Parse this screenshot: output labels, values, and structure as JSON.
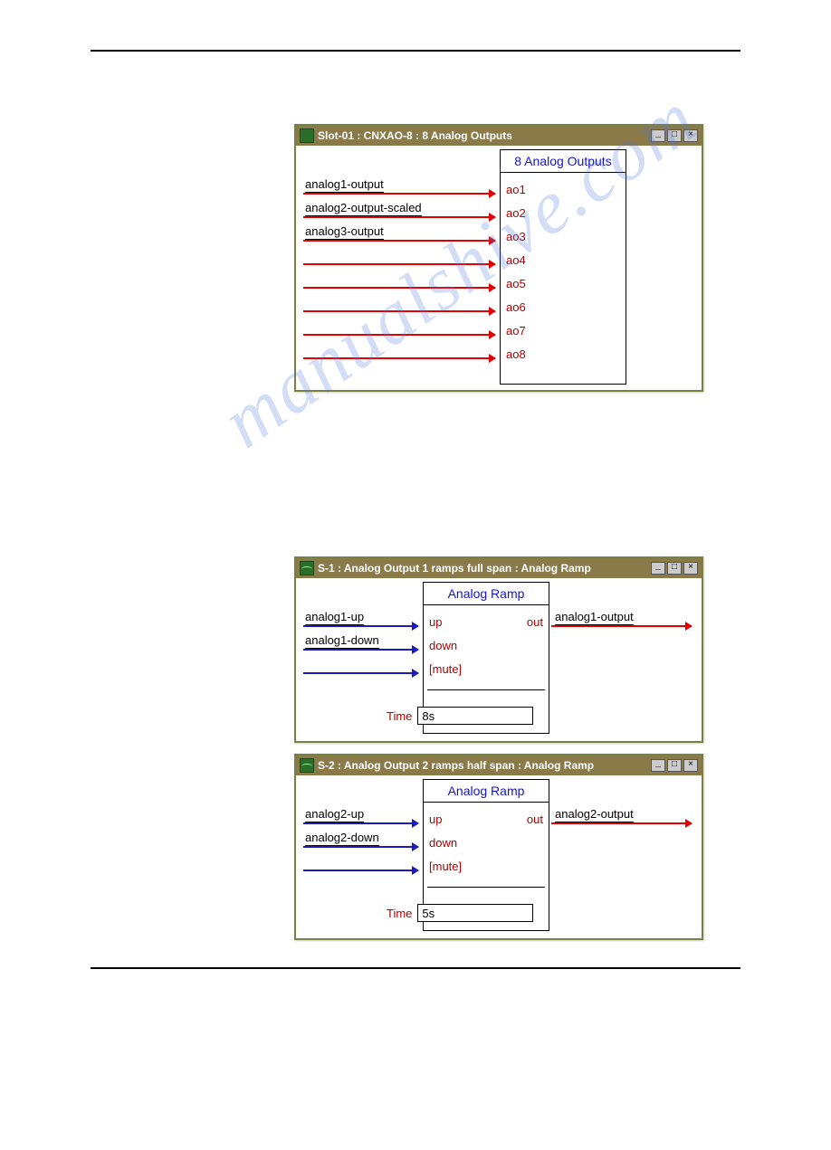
{
  "watermark": "manualshive.com",
  "win1": {
    "title": "Slot-01 : CNXAO-8 : 8 Analog Outputs",
    "header": "8 Analog Outputs",
    "ports": [
      "ao1",
      "ao2",
      "ao3",
      "ao4",
      "ao5",
      "ao6",
      "ao7",
      "ao8"
    ],
    "signals": [
      "analog1-output",
      "analog2-output-scaled",
      "analog3-output"
    ]
  },
  "win2": {
    "title": "S-1 : Analog Output 1 ramps full span : Analog Ramp",
    "header": "Analog Ramp",
    "in_ports": [
      "up",
      "down",
      "[mute]"
    ],
    "out_port": "out",
    "in_signals": [
      "analog1-up",
      "analog1-down"
    ],
    "out_signal": "analog1-output",
    "time_label": "Time",
    "time_value": "8s"
  },
  "win3": {
    "title": "S-2 : Analog Output 2 ramps half span : Analog Ramp",
    "header": "Analog Ramp",
    "in_ports": [
      "up",
      "down",
      "[mute]"
    ],
    "out_port": "out",
    "in_signals": [
      "analog2-up",
      "analog2-down"
    ],
    "out_signal": "analog2-output",
    "time_label": "Time",
    "time_value": "5s"
  },
  "tb_btns": {
    "min": "_",
    "max": "□",
    "close": "×"
  }
}
